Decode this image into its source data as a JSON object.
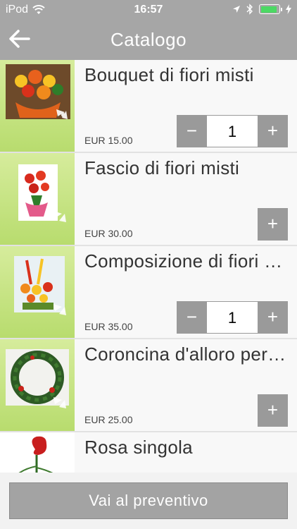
{
  "status_bar": {
    "carrier": "iPod",
    "time": "16:57"
  },
  "nav": {
    "title": "Catalogo",
    "back_icon": "back-arrow-icon"
  },
  "products": [
    {
      "title": "Bouquet di fiori misti",
      "price": "EUR 15.00",
      "has_stepper": true,
      "quantity": "1",
      "minus": "−",
      "plus": "+"
    },
    {
      "title": "Fascio di fiori misti",
      "price": "EUR 30.00",
      "has_stepper": false,
      "plus": "+"
    },
    {
      "title": "Composizione di fiori misti",
      "price": "EUR 35.00",
      "has_stepper": true,
      "quantity": "1",
      "minus": "−",
      "plus": "+"
    },
    {
      "title": "Coroncina d'alloro per laurea",
      "price": "EUR 25.00",
      "has_stepper": false,
      "plus": "+"
    },
    {
      "title": "Rosa singola",
      "price": "",
      "has_stepper": false
    }
  ],
  "footer": {
    "button_label": "Vai al preventivo"
  },
  "colors": {
    "header": "#a6a6a6",
    "thumb_green": "#c6e384",
    "button_gray": "#9a9a9a",
    "battery": "#4cd964"
  }
}
